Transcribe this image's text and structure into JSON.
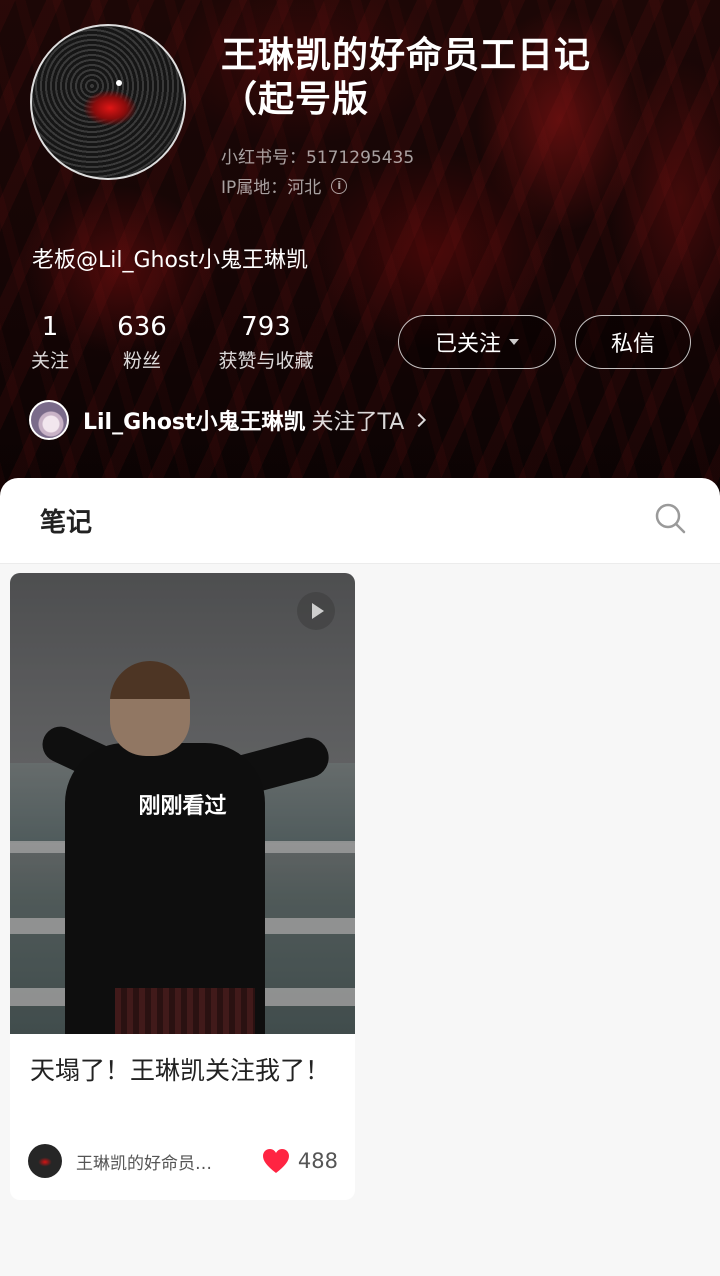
{
  "profile": {
    "name": "王琳凯的好命员工日记（起号版",
    "redbook_id": "小红书号：5171295435",
    "ip_location": "IP属地：河北",
    "bio": "老板@Lil_Ghost小鬼王琳凯"
  },
  "stats": [
    {
      "value": "1",
      "label": "关注"
    },
    {
      "value": "636",
      "label": "粉丝"
    },
    {
      "value": "793",
      "label": "获赞与收藏"
    }
  ],
  "buttons": {
    "followed": "已关注",
    "message": "私信"
  },
  "followed_by": {
    "name": "Lil_Ghost小鬼王琳凯",
    "suffix": "关注了TA"
  },
  "tabs": {
    "notes": "笔记"
  },
  "note": {
    "overlay_text": "刚刚看过",
    "title": "天塌了！王琳凯关注我了！",
    "author": "王琳凯的好命员…",
    "likes": "488"
  },
  "colors": {
    "heart": "#ff2442",
    "header_bg": "#150505"
  },
  "icons": [
    "info-icon",
    "caret-down-icon",
    "chevron-right-icon",
    "search-icon",
    "play-icon",
    "heart-icon"
  ]
}
